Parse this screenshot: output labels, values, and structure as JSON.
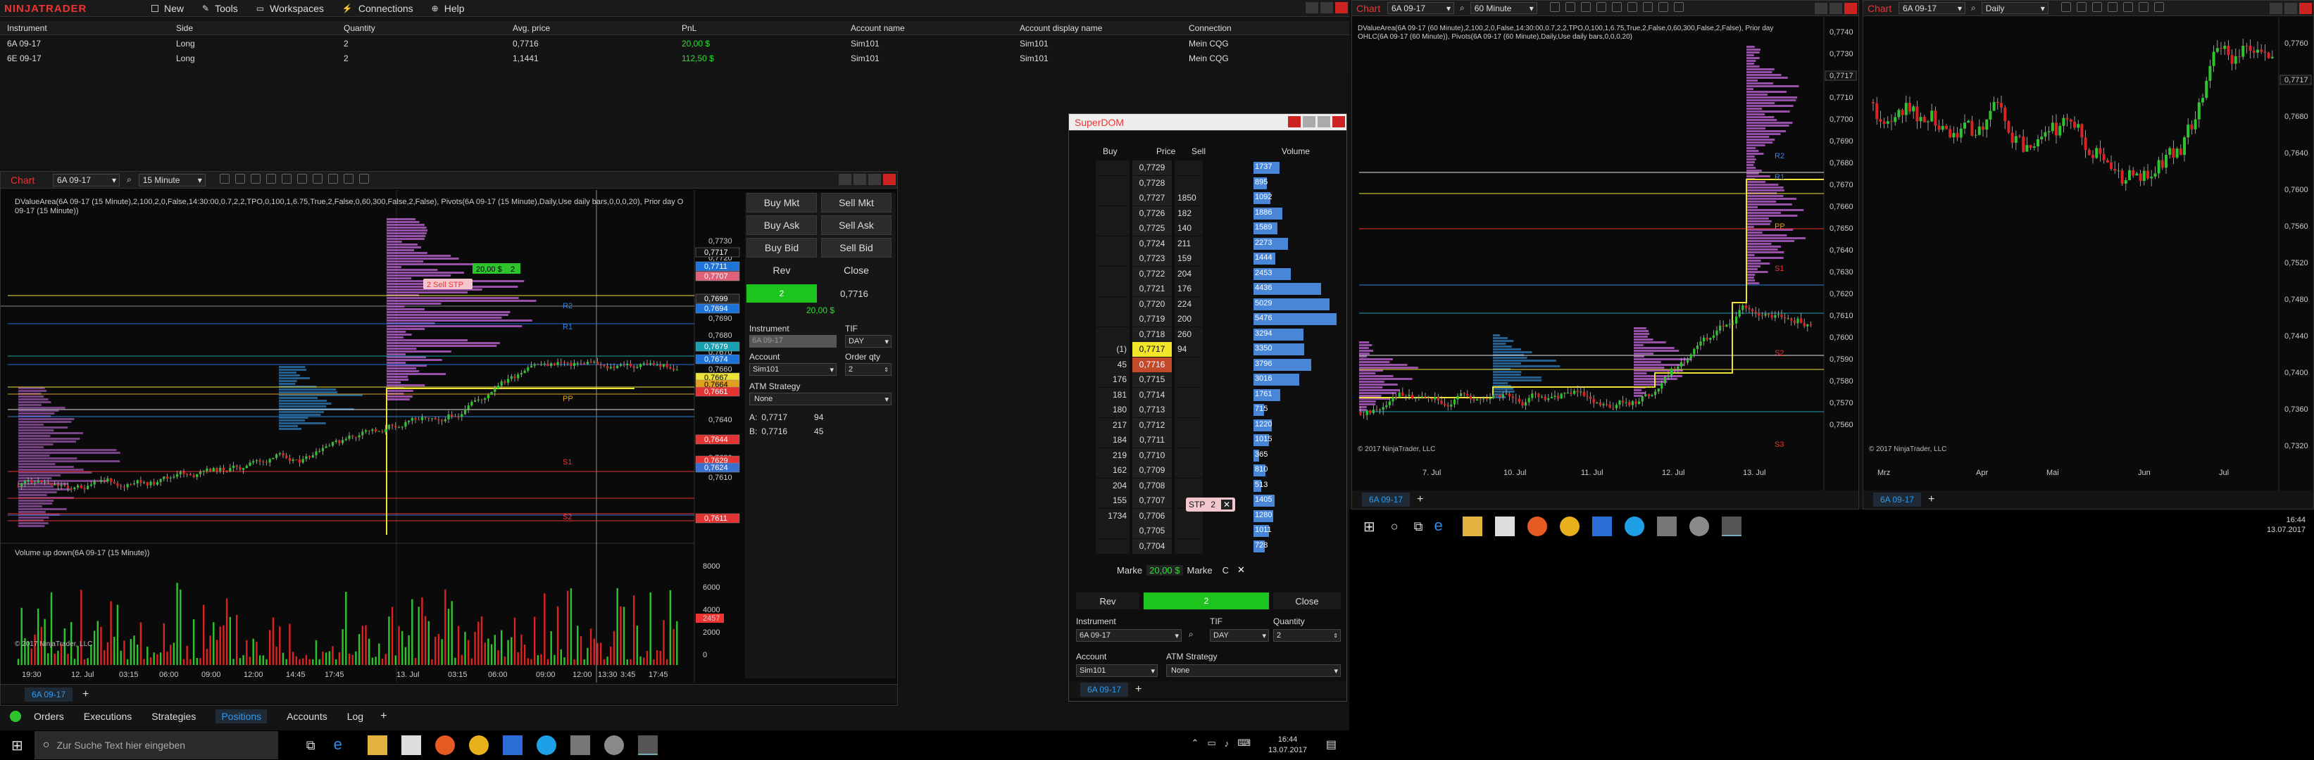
{
  "app": {
    "logo": "NINJATRADER",
    "menu": [
      "New",
      "Tools",
      "Workspaces",
      "Connections",
      "Help"
    ]
  },
  "positions": {
    "headers": [
      "Instrument",
      "Side",
      "Quantity",
      "Avg. price",
      "PnL",
      "Account name",
      "Account display name",
      "Connection"
    ],
    "rows": [
      [
        "6A 09-17",
        "Long",
        "2",
        "0,7716",
        "20,00 $",
        "Sim101",
        "Sim101",
        "Mein CQG"
      ],
      [
        "6E 09-17",
        "Long",
        "2",
        "1,1441",
        "112,50 $",
        "Sim101",
        "Sim101",
        "Mein CQG"
      ]
    ]
  },
  "chart1": {
    "title": "Chart",
    "instrument": "6A 09-17",
    "interval": "15 Minute",
    "indicator_label": "DValueArea(6A 09-17 (15 Minute),2,100,2,0,False,14:30:00,0.7,2,2,TPO,0,100,1,6.75,True,2,False,0,60,300,False,2,False), Pivots(6A 09-17 (15 Minute),Daily,Use daily bars,0,0,0,20), Prior day OHLC(6A",
    "indicator_label2": "09-17 (15 Minute))",
    "volume_label": "Volume up down(6A 09-17 (15 Minute))",
    "copyright": "© 2017 NinjaTrader, LLC",
    "tab": "6A 09-17",
    "order_tag_price": "20,00 $",
    "order_tag_qty": "2",
    "stop_label": "2 Sell STP",
    "pivot_labels": [
      "R2",
      "R1",
      "PP",
      "S1",
      "S2"
    ],
    "price_ticks": [
      "0,7730",
      "0,7720",
      "0,7710",
      "0,7690",
      "0,7680",
      "0,7670",
      "0,7660",
      "0,7650",
      "0,7640",
      "0,7630",
      "0,7620",
      "0,7610"
    ],
    "price_labels": [
      {
        "text": "0,7717",
        "color": "#ffffff",
        "bg": "#111111"
      },
      {
        "text": "0,7711",
        "color": "#ffffff",
        "bg": "#1e73d8"
      },
      {
        "text": "0,7707",
        "color": "#ffffff",
        "bg": "#e0607a"
      },
      {
        "text": "0,7699",
        "color": "#ffffff",
        "bg": "#222222"
      },
      {
        "text": "0,7694",
        "color": "#ffffff",
        "bg": "#1e73d8"
      },
      {
        "text": "0,7679",
        "color": "#ffffff",
        "bg": "#19a0b0"
      },
      {
        "text": "0,7674",
        "color": "#ffffff",
        "bg": "#1e73d8"
      },
      {
        "text": "0,7667",
        "color": "#000000",
        "bg": "#eee236"
      },
      {
        "text": "0,7664",
        "color": "#000000",
        "bg": "#e0a020"
      },
      {
        "text": "0,7661",
        "color": "#ffffff",
        "bg": "#e33333"
      },
      {
        "text": "0,7644",
        "color": "#ffffff",
        "bg": "#e33333"
      },
      {
        "text": "0,7629",
        "color": "#ffffff",
        "bg": "#e33333"
      },
      {
        "text": "0,7624",
        "color": "#ffffff",
        "bg": "#3a6fd0"
      },
      {
        "text": "0,7611",
        "color": "#ffffff",
        "bg": "#e33333"
      }
    ],
    "vol_ticks": [
      "8000",
      "6000",
      "4000",
      "2457",
      "2000",
      "0"
    ],
    "time_ticks": [
      "19:30",
      "12. Jul",
      "03:15",
      "06:00",
      "09:00",
      "12:00",
      "14:45",
      "17:45",
      "13. Jul",
      "03:15",
      "06:00",
      "09:00",
      "12:00",
      "13:30",
      "3:45",
      "17:45"
    ]
  },
  "chart_trader": {
    "buy_mkt": "Buy Mkt",
    "sell_mkt": "Sell Mkt",
    "buy_ask": "Buy Ask",
    "sell_ask": "Sell Ask",
    "buy_bid": "Buy Bid",
    "sell_bid": "Sell Bid",
    "rev": "Rev",
    "close": "Close",
    "position_qty": "2",
    "avg_price": "0,7716",
    "pnl": "20,00 $",
    "instrument_label": "Instrument",
    "instrument_value": "6A 09-17",
    "tif_label": "TIF",
    "tif_value": "DAY",
    "account_label": "Account",
    "account_value": "Sim101",
    "order_qty_label": "Order qty",
    "order_qty_value": "2",
    "atm_label": "ATM Strategy",
    "atm_value": "None",
    "ask_label": "A:",
    "ask_price": "0,7717",
    "ask_size": "94",
    "bid_label": "B:",
    "bid_price": "0,7716",
    "bid_size": "45"
  },
  "superdom": {
    "title": "SuperDOM",
    "headers": {
      "buy": "Buy",
      "price": "Price",
      "sell": "Sell",
      "volume": "Volume"
    },
    "rows": [
      {
        "buy": "",
        "price": "0,7729",
        "sell": "",
        "vol": "1737",
        "v": 1737
      },
      {
        "buy": "",
        "price": "0,7728",
        "sell": "",
        "vol": "895",
        "v": 895
      },
      {
        "buy": "",
        "price": "0,7727",
        "sell": "1850",
        "vol": "1092",
        "v": 1092
      },
      {
        "buy": "",
        "price": "0,7726",
        "sell": "182",
        "vol": "1886",
        "v": 1886
      },
      {
        "buy": "",
        "price": "0,7725",
        "sell": "140",
        "vol": "1589",
        "v": 1589
      },
      {
        "buy": "",
        "price": "0,7724",
        "sell": "211",
        "vol": "2273",
        "v": 2273
      },
      {
        "buy": "",
        "price": "0,7723",
        "sell": "159",
        "vol": "1444",
        "v": 1444
      },
      {
        "buy": "",
        "price": "0,7722",
        "sell": "204",
        "vol": "2453",
        "v": 2453
      },
      {
        "buy": "",
        "price": "0,7721",
        "sell": "176",
        "vol": "4436",
        "v": 4436
      },
      {
        "buy": "",
        "price": "0,7720",
        "sell": "224",
        "vol": "5029",
        "v": 5029
      },
      {
        "buy": "",
        "price": "0,7719",
        "sell": "200",
        "vol": "5476",
        "v": 5476
      },
      {
        "buy": "",
        "price": "0,7718",
        "sell": "260",
        "vol": "3294",
        "v": 3294
      },
      {
        "buy": "(1)",
        "price": "0,7717",
        "sell": "94",
        "vol": "3350",
        "v": 3350
      },
      {
        "buy": "45",
        "price": "0,7716",
        "sell": "",
        "vol": "3796",
        "v": 3796
      },
      {
        "buy": "176",
        "price": "0,7715",
        "sell": "",
        "vol": "3016",
        "v": 3016
      },
      {
        "buy": "181",
        "price": "0,7714",
        "sell": "",
        "vol": "1761",
        "v": 1761
      },
      {
        "buy": "180",
        "price": "0,7713",
        "sell": "",
        "vol": "715",
        "v": 715
      },
      {
        "buy": "217",
        "price": "0,7712",
        "sell": "",
        "vol": "1220",
        "v": 1220
      },
      {
        "buy": "184",
        "price": "0,7711",
        "sell": "",
        "vol": "1015",
        "v": 1015
      },
      {
        "buy": "219",
        "price": "0,7710",
        "sell": "",
        "vol": "365",
        "v": 365
      },
      {
        "buy": "162",
        "price": "0,7709",
        "sell": "",
        "vol": "810",
        "v": 810
      },
      {
        "buy": "204",
        "price": "0,7708",
        "sell": "",
        "vol": "513",
        "v": 513
      },
      {
        "buy": "155",
        "price": "0,7707",
        "sell": "",
        "vol": "1405",
        "v": 1405
      },
      {
        "buy": "1734",
        "price": "0,7706",
        "sell": "",
        "vol": "1280",
        "v": 1280
      },
      {
        "buy": "",
        "price": "0,7705",
        "sell": "",
        "vol": "1011",
        "v": 1011
      },
      {
        "buy": "",
        "price": "0,7704",
        "sell": "",
        "vol": "728",
        "v": 728
      }
    ],
    "stp_label": "STP",
    "stp_qty": "2",
    "market_left": "Marke",
    "market_pnl": "20,00 $",
    "market_right": "Marke",
    "c_label": "C",
    "rev": "Rev",
    "qty": "2",
    "close": "Close",
    "instrument_label": "Instrument",
    "instrument_value": "6A 09-17",
    "tif_label": "TIF",
    "tif_value": "DAY",
    "quantity_label": "Quantity",
    "quantity_value": "2",
    "account_label": "Account",
    "account_value": "Sim101",
    "atm_label": "ATM Strategy",
    "atm_value": "None",
    "tab": "6A 09-17"
  },
  "chart2": {
    "title": "Chart",
    "instrument": "6A 09-17",
    "interval": "60 Minute",
    "indicator_label": "DValueArea(6A 09-17 (60 Minute),2,100,2,0,False,14:30:00,0.7,2,2,TPO,0,100,1,6.75,True,2,False,0,60,300,False,2,False), Prior day",
    "indicator_label2": "OHLC(6A 09-17 (60 Minute)), Pivots(6A 09-17 (60 Minute),Daily,Use daily bars,0,0,0,20)",
    "pivot_labels": [
      "R2",
      "R1",
      "PP",
      "S1",
      "S2",
      "S3"
    ],
    "price_ticks": [
      "0,7740",
      "0,7730",
      "0,7717",
      "0,7710",
      "0,7700",
      "0,7690",
      "0,7680",
      "0,7670",
      "0,7660",
      "0,7650",
      "0,7640",
      "0,7630",
      "0,7620",
      "0,7610",
      "0,7600",
      "0,7590",
      "0,7580",
      "0,7570",
      "0,7560"
    ],
    "time_ticks": [
      "7. Jul",
      "10. Jul",
      "11. Jul",
      "12. Jul",
      "13. Jul"
    ],
    "copyright": "© 2017 NinjaTrader, LLC",
    "tab": "6A 09-17"
  },
  "chart3": {
    "title": "Chart",
    "instrument": "6A 09-17",
    "interval": "Daily",
    "price_ticks": [
      "0,7760",
      "0,7717",
      "0,7680",
      "0,7640",
      "0,7600",
      "0,7560",
      "0,7520",
      "0,7480",
      "0,7440",
      "0,7400",
      "0,7360",
      "0,7320"
    ],
    "time_ticks": [
      "Mrz",
      "Apr",
      "Mai",
      "Jun",
      "Jul"
    ],
    "copyright": "© 2017 NinjaTrader, LLC",
    "tab": "6A 09-17"
  },
  "bottom_tabs": [
    "Orders",
    "Executions",
    "Strategies",
    "Positions",
    "Accounts",
    "Log"
  ],
  "taskbar": {
    "search_placeholder": "Zur Suche Text hier eingeben",
    "time": "16:44",
    "date": "13.07.2017"
  }
}
